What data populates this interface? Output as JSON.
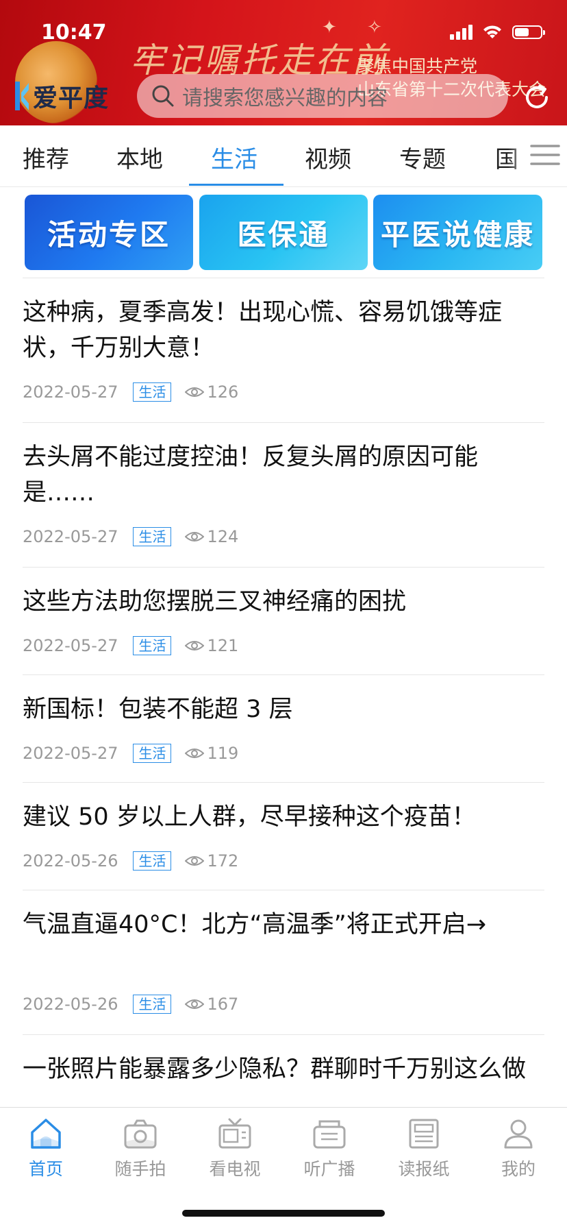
{
  "status_bar": {
    "time": "10:47",
    "battery_level": 0.55
  },
  "header": {
    "banner_calligraphy": "牢记嘱托走在前",
    "banner_line1": "聚焦中国共产党",
    "banner_line2": "山东省第十二次代表大会",
    "logo_text": "爱平度",
    "search_placeholder": "请搜索您感兴趣的内容"
  },
  "tabs": [
    {
      "label": "推荐"
    },
    {
      "label": "本地"
    },
    {
      "label": "生活",
      "active": true
    },
    {
      "label": "视频"
    },
    {
      "label": "专题"
    },
    {
      "label": "国"
    }
  ],
  "quick_links": [
    {
      "label": "活动专区"
    },
    {
      "label": "医保通"
    },
    {
      "label": "平医说健康"
    }
  ],
  "news": [
    {
      "title": "这种病，夏季高发！出现心慌、容易饥饿等症状，千万别大意！",
      "date": "2022-05-27",
      "tag": "生活",
      "views": "126"
    },
    {
      "title": "去头屑不能过度控油！反复头屑的原因可能是……",
      "date": "2022-05-27",
      "tag": "生活",
      "views": "124"
    },
    {
      "title": "这些方法助您摆脱三叉神经痛的困扰",
      "date": "2022-05-27",
      "tag": "生活",
      "views": "121"
    },
    {
      "title": "新国标！包装不能超 3 层",
      "date": "2022-05-27",
      "tag": "生活",
      "views": "119"
    },
    {
      "title": "建议 50 岁以上人群，尽早接种这个疫苗！",
      "date": "2022-05-26",
      "tag": "生活",
      "views": "172"
    },
    {
      "title": "气温直逼40°C！北方“高温季”将正式开启→",
      "date": "2022-05-26",
      "tag": "生活",
      "views": "167"
    },
    {
      "title": "一张照片能暴露多少隐私？群聊时千万别这么做",
      "date": "",
      "tag": "",
      "views": ""
    }
  ],
  "bottom_nav": [
    {
      "label": "首页",
      "icon": "home-icon",
      "active": true
    },
    {
      "label": "随手拍",
      "icon": "camera-icon"
    },
    {
      "label": "看电视",
      "icon": "tv-icon"
    },
    {
      "label": "听广播",
      "icon": "radio-icon"
    },
    {
      "label": "读报纸",
      "icon": "newspaper-icon"
    },
    {
      "label": "我的",
      "icon": "user-icon"
    }
  ],
  "colors": {
    "accent": "#2a8de6",
    "banner_red": "#d4141a"
  }
}
